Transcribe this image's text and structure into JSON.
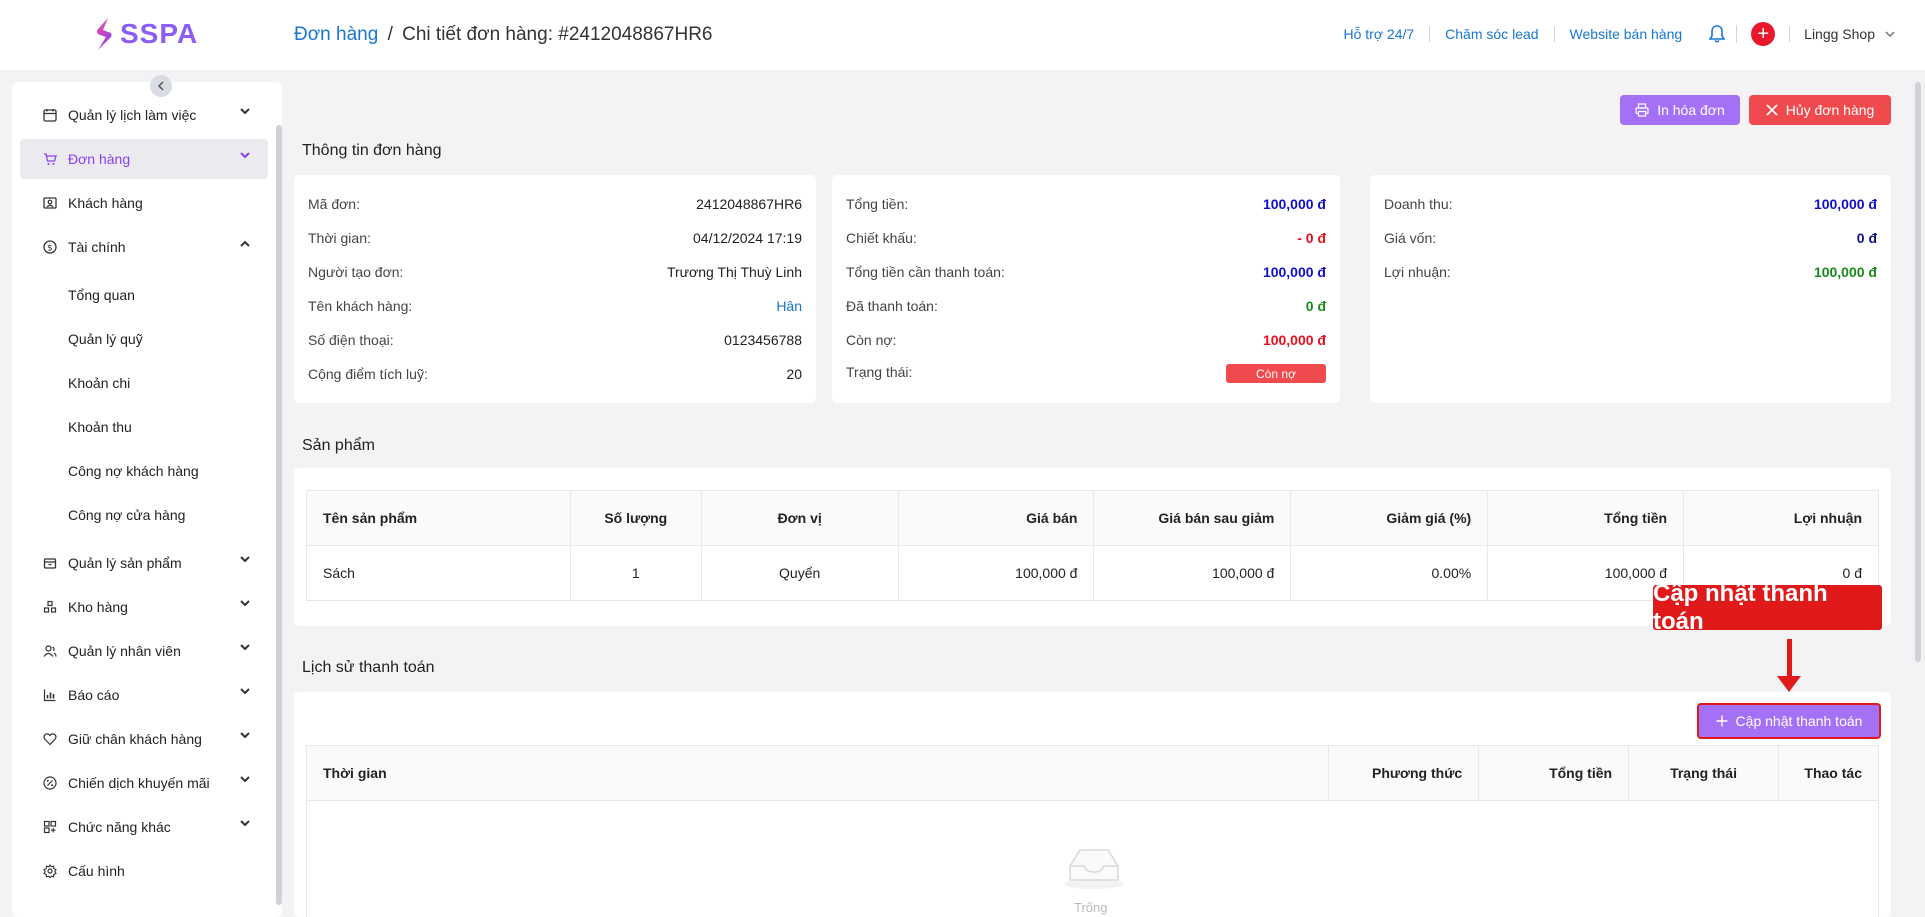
{
  "app": {
    "logo_text": "SSPA",
    "brand_color": "#8b5cf6"
  },
  "breadcrumb": {
    "parent": "Đơn hàng",
    "separator": "/",
    "current": "Chi tiết đơn hàng: #2412048867HR6"
  },
  "topbar": {
    "links": [
      "Hỗ trợ 24/7",
      "Chăm sóc lead",
      "Website bán hàng"
    ],
    "shop_name": "Lingg Shop",
    "icons": [
      "bell-icon",
      "plus-circle-icon",
      "chevron-down-icon"
    ]
  },
  "sidebar": {
    "items": [
      {
        "label": "Quản lý lịch làm việc",
        "icon": "calendar-icon",
        "chevron": "down"
      },
      {
        "label": "Đơn hàng",
        "icon": "cart-icon",
        "chevron": "down",
        "active": true
      },
      {
        "label": "Khách hàng",
        "icon": "contact-card-icon",
        "chevron": ""
      },
      {
        "label": "Tài chính",
        "icon": "dollar-circle-icon",
        "chevron": "up"
      },
      {
        "label": "Quản lý sản phẩm",
        "icon": "box-icon",
        "chevron": "down"
      },
      {
        "label": "Kho hàng",
        "icon": "warehouse-icon",
        "chevron": "down"
      },
      {
        "label": "Quản lý nhân viên",
        "icon": "users-icon",
        "chevron": "down"
      },
      {
        "label": "Báo cáo",
        "icon": "bar-chart-icon",
        "chevron": "down"
      },
      {
        "label": "Giữ chân khách hàng",
        "icon": "heart-icon",
        "chevron": "down"
      },
      {
        "label": "Chiến dịch khuyến mãi",
        "icon": "percent-icon",
        "chevron": "down"
      },
      {
        "label": "Chức năng khác",
        "icon": "grid-icon",
        "chevron": "down"
      },
      {
        "label": "Cấu hình",
        "icon": "gear-icon",
        "chevron": ""
      }
    ],
    "finance_sub": [
      "Tổng quan",
      "Quản lý quỹ",
      "Khoản chi",
      "Khoản thu",
      "Công nợ khách hàng",
      "Công nợ cửa hàng"
    ]
  },
  "actions": {
    "print": "In hóa đơn",
    "cancel": "Hủy đơn hàng"
  },
  "order_info": {
    "title": "Thông tin đơn hàng",
    "left": [
      {
        "label": "Mã đơn:",
        "value": "2412048867HR6"
      },
      {
        "label": "Thời gian:",
        "value": "04/12/2024 17:19"
      },
      {
        "label": "Người tạo đơn:",
        "value": "Trương Thị Thuỳ Linh"
      },
      {
        "label": "Tên khách hàng:",
        "value": "Hân"
      },
      {
        "label": "Số điện thoại:",
        "value": "0123456788"
      },
      {
        "label": "Cộng điểm tích luỹ:",
        "value": "20"
      }
    ],
    "middle": [
      {
        "label": "Tổng tiền:",
        "value": "100,000 đ"
      },
      {
        "label": "Chiết khấu:",
        "value": "- 0 đ"
      },
      {
        "label": "Tổng tiền cần thanh toán:",
        "value": "100,000 đ"
      },
      {
        "label": "Đã thanh toán:",
        "value": "0 đ"
      },
      {
        "label": "Còn nợ:",
        "value": "100,000 đ"
      },
      {
        "label": "Trạng thái:",
        "value": "Còn nợ"
      }
    ],
    "right": [
      {
        "label": "Doanh thu:",
        "value": "100,000 đ"
      },
      {
        "label": "Giá vốn:",
        "value": "0 đ"
      },
      {
        "label": "Lợi nhuận:",
        "value": "100,000 đ"
      }
    ]
  },
  "products": {
    "title": "Sản phẩm",
    "columns": [
      "Tên sản phẩm",
      "Số lượng",
      "Đơn vị",
      "Giá bán",
      "Giá bán sau giảm",
      "Giảm giá (%)",
      "Tổng tiền",
      "Lợi nhuận"
    ],
    "rows": [
      [
        "Sách",
        "1",
        "Quyển",
        "100,000 đ",
        "100,000 đ",
        "0.00%",
        "100,000 đ",
        "0 đ"
      ]
    ]
  },
  "payments": {
    "title": "Lịch sử thanh toán",
    "update_button": "Cập nhật thanh toán",
    "callout": "Cập nhật thanh toán",
    "columns": [
      "Thời gian",
      "Phương thức",
      "Tổng tiền",
      "Trạng thái",
      "Thao tác"
    ],
    "empty_text": "Trống"
  },
  "colors": {
    "accent": "#a470f5",
    "danger": "#f04a4f",
    "link": "#1976d2",
    "callout": "#e01a1a"
  }
}
